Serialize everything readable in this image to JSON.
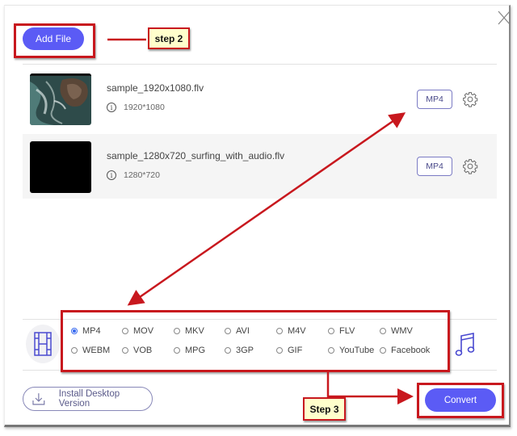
{
  "window": {
    "close_label": "Close"
  },
  "toolbar": {
    "add_file_label": "Add File"
  },
  "files": [
    {
      "name": "sample_1920x1080.flv",
      "resolution": "1920*1080",
      "format": "MP4",
      "thumbnail": "ocean-rocks"
    },
    {
      "name": "sample_1280x720_surfing_with_audio.flv",
      "resolution": "1280*720",
      "format": "MP4",
      "thumbnail": "black"
    }
  ],
  "formats": {
    "selected": "MP4",
    "row1": [
      "MP4",
      "MOV",
      "MKV",
      "AVI",
      "M4V",
      "FLV",
      "WMV"
    ],
    "row2": [
      "WEBM",
      "VOB",
      "MPG",
      "3GP",
      "GIF",
      "YouTube",
      "Facebook"
    ]
  },
  "footer": {
    "install_label": "Install Desktop Version",
    "convert_label": "Convert"
  },
  "annotations": {
    "step2": "step 2",
    "step3": "Step 3",
    "color": "#c8181e"
  },
  "colors": {
    "accent": "#5b5bf5",
    "radio_selected": "#3c6df0"
  }
}
